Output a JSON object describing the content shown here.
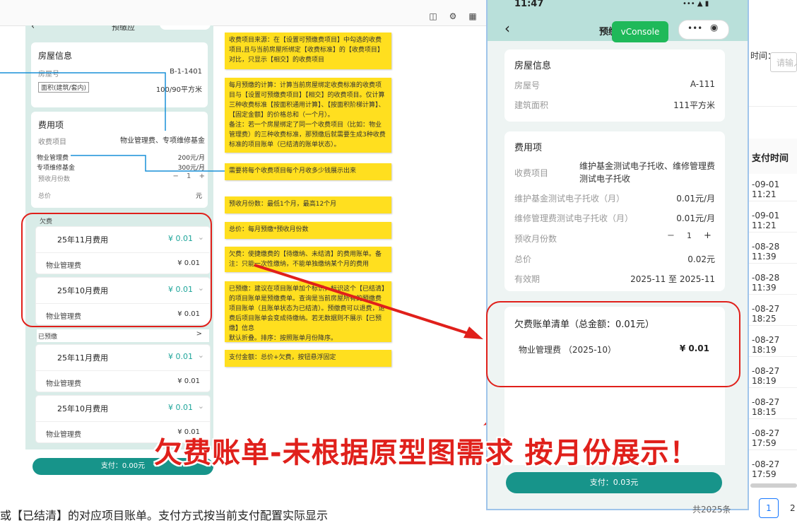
{
  "toolbar": {
    "icons": [
      "book-icon",
      "settings-icon",
      "grid-icon"
    ]
  },
  "colors": {
    "teal": "#17948a",
    "yellow_note": "#ffdf1f",
    "red_mark": "#e0201b",
    "annotation_line": "#1890d8"
  },
  "left_proto": {
    "header_title": "预缴应",
    "house": {
      "title": "房屋信息",
      "room_label": "房屋号",
      "room_value": "B-1-1401",
      "area_label": "面积(建筑/套内)",
      "area_value": "100/90平方米"
    },
    "fees": {
      "title": "费用项",
      "item_label": "收费项目",
      "item_value": "物业管理费、专项维修基金",
      "fee1_label": "物业管理费",
      "fee1_value": "200元/月",
      "fee2_label": "专项维修基金",
      "fee2_value": "300元/月",
      "months_label": "预收月份数",
      "months_value": "1",
      "total_label": "总价",
      "total_value": "元"
    },
    "arrears": {
      "title": "欠费",
      "months": [
        {
          "title": "25年11月费用",
          "amount": "¥ 0.01",
          "item": "物业管理费",
          "item_amount": "¥ 0.01"
        },
        {
          "title": "25年10月费用",
          "amount": "¥ 0.01",
          "item": "物业管理费",
          "item_amount": "¥ 0.01"
        }
      ]
    },
    "prepaid": {
      "title": "已预缴",
      "chevron": ">",
      "months": [
        {
          "title": "25年11月费用",
          "amount": "¥ 0.01",
          "item": "物业管理费",
          "item_amount": "¥ 0.01"
        },
        {
          "title": "25年10月费用",
          "amount": "¥ 0.01",
          "item": "物业管理费",
          "item_amount": "¥ 0.01"
        }
      ]
    },
    "pay_button": "支付：0.00元"
  },
  "notes": [
    "收费项目来源：在【设置可预缴费项目】中勾选的收费项目,且与当前房屋所绑定【收费标准】的【收费项目】对比，只显示【相交】的收费项目",
    "每月预缴的计算：计算当前房屋绑定收费标准的收费项目与【设置可预缴费项目】【相交】的收费项目。仅计算三种收费标准【按面积通用计算】、【按面积阶梯计算】、【固定金额】的价格总和（一个月）。\n备注：若一个房屋绑定了同一个收费项目（比如：物业管理费）的三种收费标准，那预缴后就需要生成3种收费标准的项目账单（已结清的账单状态）。",
    "需要将每个收费项目每个月收多少钱展示出来",
    "预收月份数：最低1个月，最高12个月",
    "总价：每月预缴*预收月份数",
    "欠费：使捷缴费的【待缴纳、未结清】的费用账单。备注：只能一次性缴纳，不能单独缴纳某个月的费用",
    "已预缴：建议在项目账单加个标识，标识这个【已结清】的项目账单是预缴费单。查询是当前房屋所有的预缴费项目账单（且账单状态为已结清）。预缴费可以退费，退费后项目账单会变成待缴纳。若无数据则不展示【已预缴】信息\n默认折叠。排序：按照账单月份降序。",
    "支付金额：总价+欠费，按钮悬浮固定"
  ],
  "bottom_text": "或【已结清】的对应项目账单。支付方式按当前支付配置实际显示",
  "phone": {
    "time": "11:47",
    "nav_title": "预缴",
    "vconsole": "vConsole",
    "house": {
      "title": "房屋信息",
      "room_label": "房屋号",
      "room_value": "A-111",
      "area_label": "建筑面积",
      "area_value": "111平方米"
    },
    "fees": {
      "title": "费用项",
      "item_label": "收费项目",
      "item_value": "维护基金测试电子托收、维修管理费测试电子托收",
      "fee1_label": "维护基金测试电子托收（月）",
      "fee1_value": "0.01元/月",
      "fee2_label": "维修管理费测试电子托收（月）",
      "fee2_value": "0.01元/月",
      "months_label": "预收月份数",
      "months_value": "1",
      "total_label": "总价",
      "total_value": "0.02元",
      "period_label": "有效期",
      "period_value": "2025-11 至 2025-11"
    },
    "arrears": {
      "title": "欠费账单清单（总金额：0.01元）",
      "item": "物业管理费 （2025-10）",
      "amount": "¥ 0.01"
    },
    "pay_button": "支付：0.03元"
  },
  "annotation": "欠费账单-未根据原型图需求 按月份展示！",
  "right_panel": {
    "filter_label": "时间：",
    "filter_placeholder": "请输入",
    "column_header": "支付时间",
    "rows": [
      "-09-01 11:21",
      "-09-01 11:21",
      "-08-28 11:39",
      "-08-28 11:39",
      "-08-27 18:25",
      "-08-27 18:19",
      "-08-27 18:19",
      "-08-27 18:15",
      "-08-27 17:59",
      "-08-27 17:59"
    ],
    "total_text": "共2025条",
    "pages": [
      "1",
      "2"
    ]
  }
}
